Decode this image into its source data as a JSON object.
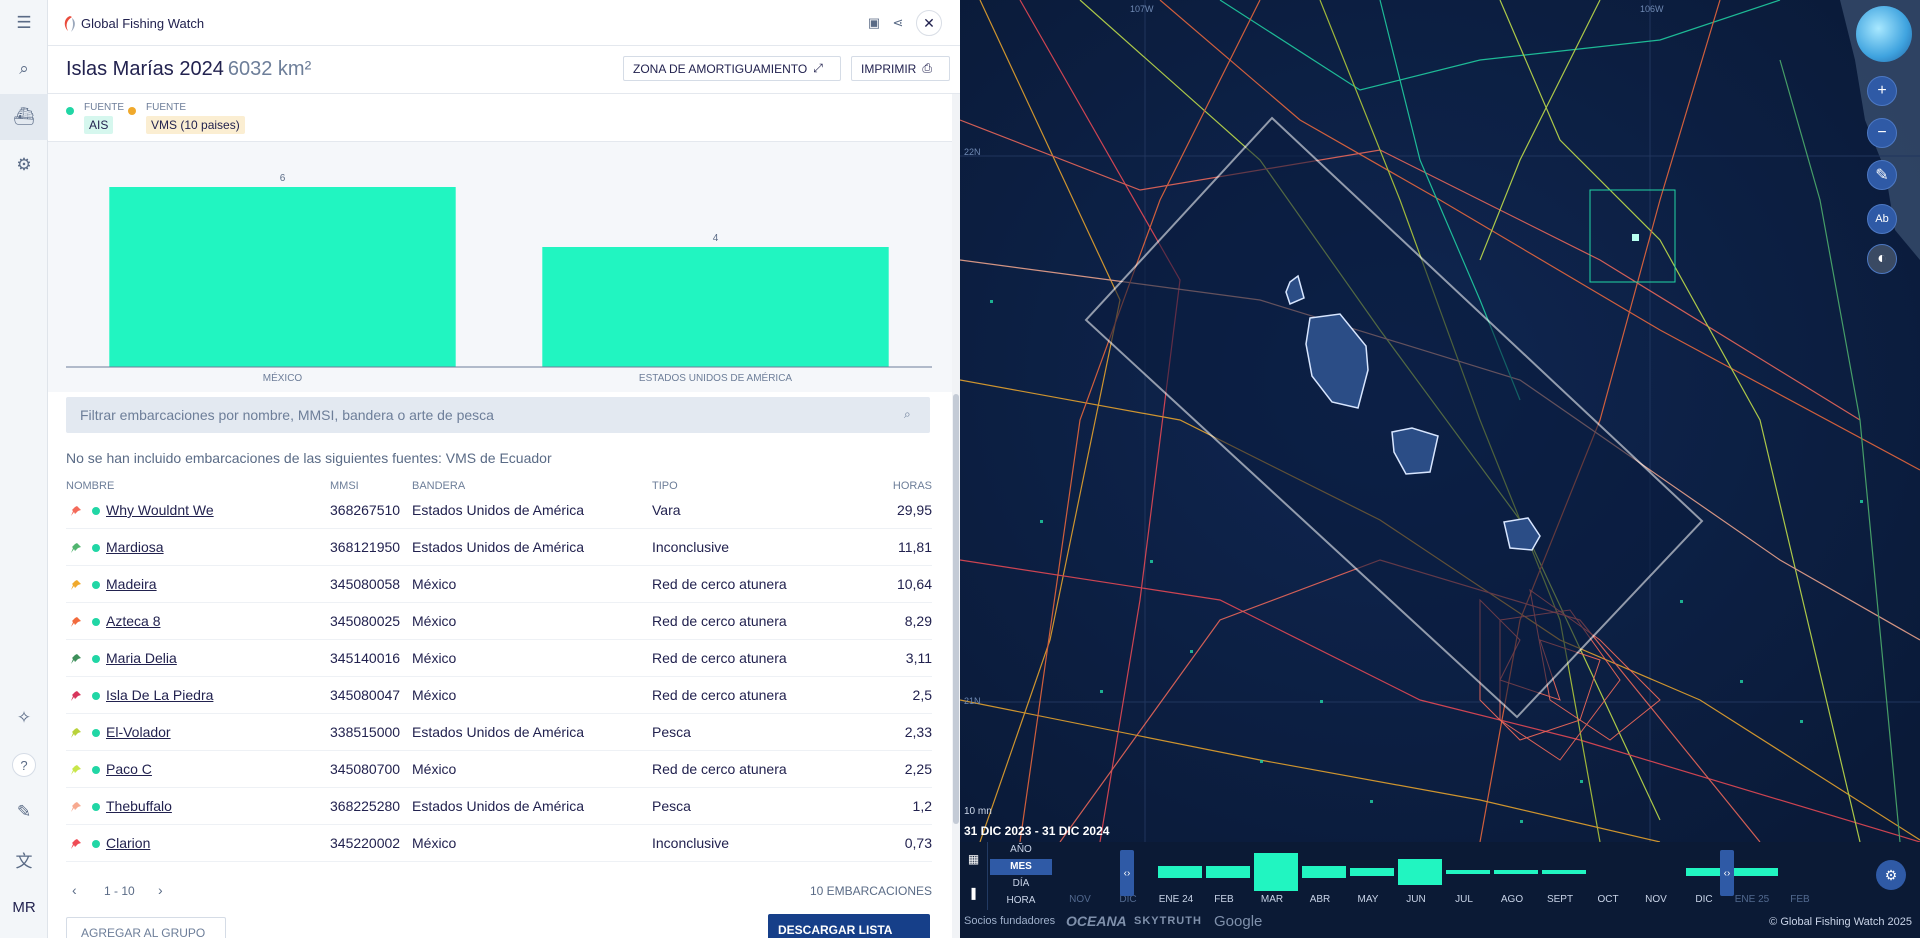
{
  "app": {
    "title": "Global Fishing Watch",
    "user_initials": "MR"
  },
  "area": {
    "title": "Islas Marías 2024",
    "size": "6032 km²",
    "buffer_button": "ZONA DE AMORTIGUAMIENTO",
    "print_button": "IMPRIMIR"
  },
  "sources": [
    {
      "label": "FUENTE",
      "value": "AIS",
      "color": "#21d6a5"
    },
    {
      "label": "FUENTE",
      "value": "VMS (10 paises)",
      "color": "#f0a92c"
    }
  ],
  "chart_data": {
    "type": "bar",
    "categories": [
      "MÉXICO",
      "ESTADOS UNIDOS DE AMÉRICA"
    ],
    "values": [
      6,
      4
    ],
    "ylim": [
      0,
      6
    ],
    "color": "#21f5c1",
    "title": "",
    "xlabel": "",
    "ylabel": ""
  },
  "search": {
    "placeholder": "Filtrar embarcaciones por nombre, MMSI, bandera o arte de pesca"
  },
  "note": "No se han incluido embarcaciones de las siguientes fuentes: VMS de Ecuador",
  "table": {
    "headers": {
      "name": "NOMBRE",
      "mmsi": "MMSI",
      "flag": "BANDERA",
      "type": "TIPO",
      "hours": "HORAS"
    },
    "rows": [
      {
        "name": "Why Wouldnt We",
        "mmsi": "368267510",
        "flag": "Estados Unidos de América",
        "type": "Vara",
        "hours": "29,95",
        "pin": "#f46a5a"
      },
      {
        "name": "Mardiosa",
        "mmsi": "368121950",
        "flag": "Estados Unidos de América",
        "type": "Inconclusive",
        "hours": "11,81",
        "pin": "#51b56f"
      },
      {
        "name": "Madeira",
        "mmsi": "345080058",
        "flag": "México",
        "type": "Red de cerco atunera",
        "hours": "10,64",
        "pin": "#f0a92c"
      },
      {
        "name": "Azteca 8",
        "mmsi": "345080025",
        "flag": "México",
        "type": "Red de cerco atunera",
        "hours": "8,29",
        "pin": "#f26a3c"
      },
      {
        "name": "Maria Delia",
        "mmsi": "345140016",
        "flag": "México",
        "type": "Red de cerco atunera",
        "hours": "3,11",
        "pin": "#3d8f5a"
      },
      {
        "name": "Isla De La Piedra",
        "mmsi": "345080047",
        "flag": "México",
        "type": "Red de cerco atunera",
        "hours": "2,5",
        "pin": "#d8365c"
      },
      {
        "name": "El-Volador",
        "mmsi": "338515000",
        "flag": "Estados Unidos de América",
        "type": "Pesca",
        "hours": "2,33",
        "pin": "#b9d23a"
      },
      {
        "name": "Paco C",
        "mmsi": "345080700",
        "flag": "México",
        "type": "Red de cerco atunera",
        "hours": "2,25",
        "pin": "#c8e64a"
      },
      {
        "name": "Thebuffalo",
        "mmsi": "368225280",
        "flag": "Estados Unidos de América",
        "type": "Pesca",
        "hours": "1,2",
        "pin": "#f7a98f"
      },
      {
        "name": "Clarion",
        "mmsi": "345220002",
        "flag": "México",
        "type": "Inconclusive",
        "hours": "0,73",
        "pin": "#ef4b55"
      }
    ]
  },
  "pagination": {
    "range": "1 - 10",
    "total": "10 EMBARCACIONES"
  },
  "actions": {
    "add_group": "AGREGAR AL GRUPO",
    "download": "DESCARGAR LISTA (CSV)"
  },
  "map": {
    "coords": [
      "106W",
      "107W",
      "22N",
      "21N"
    ],
    "scale": "10 mn",
    "range": "31 DIC 2023 - 31 DIC 2024",
    "draw_label": "Ab"
  },
  "timebar": {
    "resolutions": [
      "AÑO",
      "MES",
      "DÍA",
      "HORA"
    ],
    "active_resolution": "MES",
    "months": [
      "NOV",
      "DIC",
      "ENE 24",
      "FEB",
      "MAR",
      "ABR",
      "MAY",
      "JUN",
      "JUL",
      "AGO",
      "SEPT",
      "OCT",
      "NOV",
      "DIC",
      "ENE 25",
      "FEB"
    ],
    "activity": [
      0,
      0,
      0.3,
      0.3,
      1.0,
      0.3,
      0.2,
      0.7,
      0.1,
      0.1,
      0.1,
      0,
      0,
      0.2,
      0.2,
      0
    ]
  },
  "footer": {
    "partners_label": "Socios fundadores",
    "partners": [
      "OCEANA",
      "SKYTRUTH",
      "Google"
    ],
    "copyright": "© Global Fishing Watch 2025"
  },
  "colors": {
    "accent": "#163f89",
    "ais": "#21d6a5",
    "vms": "#f0a92c"
  }
}
